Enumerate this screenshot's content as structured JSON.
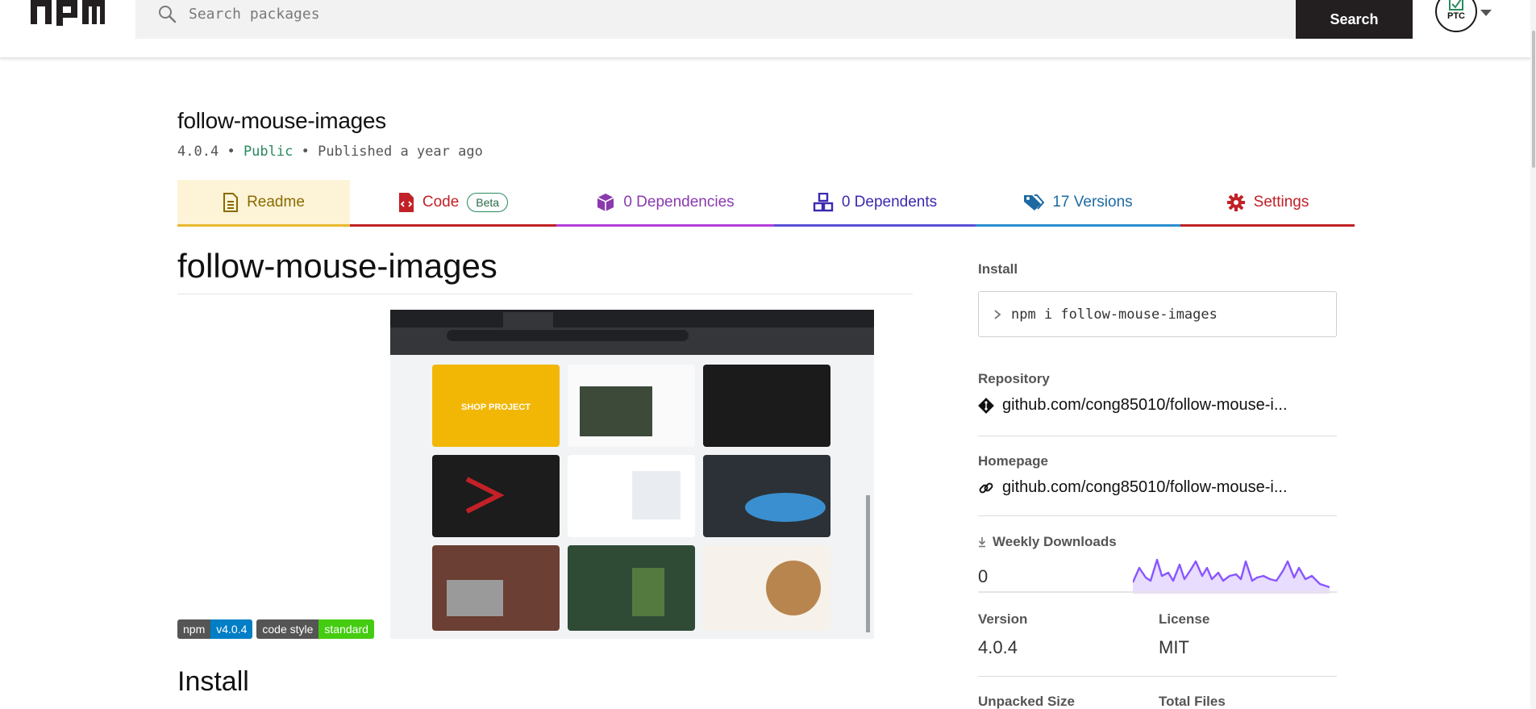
{
  "header": {
    "logo_text": "npm",
    "search_placeholder": "Search packages",
    "search_button": "Search",
    "avatar_text": "PTC"
  },
  "package": {
    "name": "follow-mouse-images",
    "version": "4.0.4",
    "visibility": "Public",
    "published": "Published a year ago",
    "separator": "•"
  },
  "tabs": [
    {
      "label": "Readme",
      "icon": "file-text-icon"
    },
    {
      "label": "Code",
      "icon": "code-file-icon",
      "badge": "Beta"
    },
    {
      "label": "0 Dependencies",
      "icon": "box-icon"
    },
    {
      "label": "0 Dependents",
      "icon": "boxes-icon"
    },
    {
      "label": "17 Versions",
      "icon": "tags-icon"
    },
    {
      "label": "Settings",
      "icon": "gear-icon"
    }
  ],
  "readme": {
    "title": "follow-mouse-images",
    "badges": [
      {
        "left": "npm",
        "right": "v4.0.4",
        "color": "#007ec6"
      },
      {
        "left": "code style",
        "right": "standard",
        "color": "#44cc11"
      }
    ],
    "install_heading": "Install",
    "screenshot_tile_text": "SHOP PROJECT"
  },
  "sidebar": {
    "install_label": "Install",
    "install_command": "npm i follow-mouse-images",
    "repository_label": "Repository",
    "repository_link": "github.com/cong85010/follow-mouse-i...",
    "homepage_label": "Homepage",
    "homepage_link": "github.com/cong85010/follow-mouse-i...",
    "weekly_downloads_label": "Weekly Downloads",
    "weekly_downloads_value": "0",
    "version_label": "Version",
    "version_value": "4.0.4",
    "license_label": "License",
    "license_value": "MIT",
    "unpacked_size_label": "Unpacked Size",
    "total_files_label": "Total Files",
    "sparkline_color": "#8956ff"
  },
  "colors": {
    "readme_tab": "#8a6b00",
    "code_tab": "#c12127",
    "deps_tab": "#8a3aae",
    "dependents_tab": "#3a2ab0",
    "versions_tab": "#1d6aa3",
    "settings_tab": "#c12127",
    "public_text": "#2a8a5f"
  }
}
